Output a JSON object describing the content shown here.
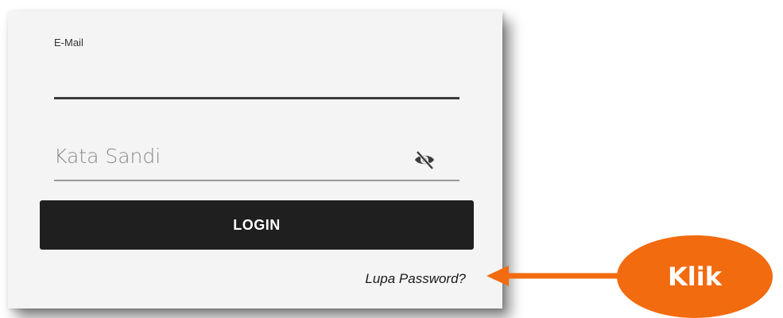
{
  "form": {
    "email_label": "E-Mail",
    "email_value": "",
    "password_placeholder": "Kata Sandi",
    "password_visibility_icon": "eye-off-icon",
    "login_label": "LOGIN",
    "forgot_password_label": "Lupa Password?"
  },
  "annotation": {
    "callout_label": "Klik",
    "callout_color": "#f26b0f"
  }
}
